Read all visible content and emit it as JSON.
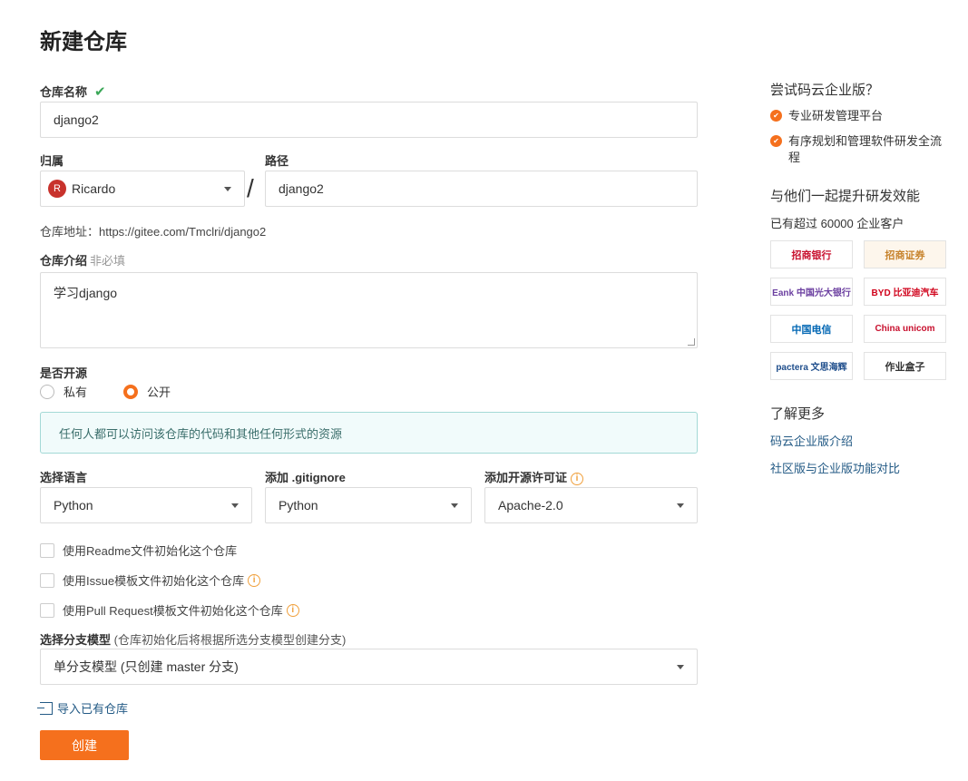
{
  "page": {
    "title": "新建仓库"
  },
  "repo_name": {
    "label": "仓库名称",
    "value": "django2"
  },
  "owner": {
    "label": "归属",
    "avatar_letter": "R",
    "value": "Ricardo"
  },
  "path": {
    "label": "路径",
    "value": "django2"
  },
  "separator": "/",
  "repo_address": "仓库地址：https://gitee.com/Tmclri/django2",
  "description": {
    "label": "仓库介绍",
    "optional": "非必填",
    "value": "学习django"
  },
  "visibility": {
    "label": "是否开源",
    "options": [
      {
        "label": "私有",
        "selected": false
      },
      {
        "label": "公开",
        "selected": true
      }
    ],
    "notice": "任何人都可以访问该仓库的代码和其他任何形式的资源"
  },
  "language": {
    "label": "选择语言",
    "value": "Python"
  },
  "gitignore": {
    "label": "添加 .gitignore",
    "value": "Python"
  },
  "license": {
    "label": "添加开源许可证",
    "value": "Apache-2.0"
  },
  "init_options": [
    {
      "label": "使用Readme文件初始化这个仓库",
      "checked": false,
      "info": false
    },
    {
      "label": "使用Issue模板文件初始化这个仓库",
      "checked": false,
      "info": true
    },
    {
      "label": "使用Pull Request模板文件初始化这个仓库",
      "checked": false,
      "info": true
    }
  ],
  "branch_model": {
    "label": "选择分支模型",
    "hint": "(仓库初始化后将根据所选分支模型创建分支)",
    "value": "单分支模型 (只创建 master 分支)"
  },
  "import_link": "导入已有仓库",
  "create_button": "创建",
  "sidebar": {
    "enterprise_title": "尝试码云企业版？",
    "features": [
      "专业研发管理平台",
      "有序规划和管理软件研发全流程"
    ],
    "together_title": "与他们一起提升研发效能",
    "customers": "已有超过 60000 企业客户",
    "logos": [
      "招商银行",
      "招商证券",
      "Eank 中国光大银行",
      "BYD 比亚迪汽车",
      "中国电信",
      "China unicom",
      "pactera 文思海辉",
      "作业盒子"
    ],
    "more_title": "了解更多",
    "links": [
      "码云企业版介绍",
      "社区版与企业版功能对比"
    ]
  },
  "colors": {
    "accent": "#f5701d",
    "link": "#235a85",
    "notice_bg": "#f1fbfb",
    "check": "#3aa757"
  }
}
